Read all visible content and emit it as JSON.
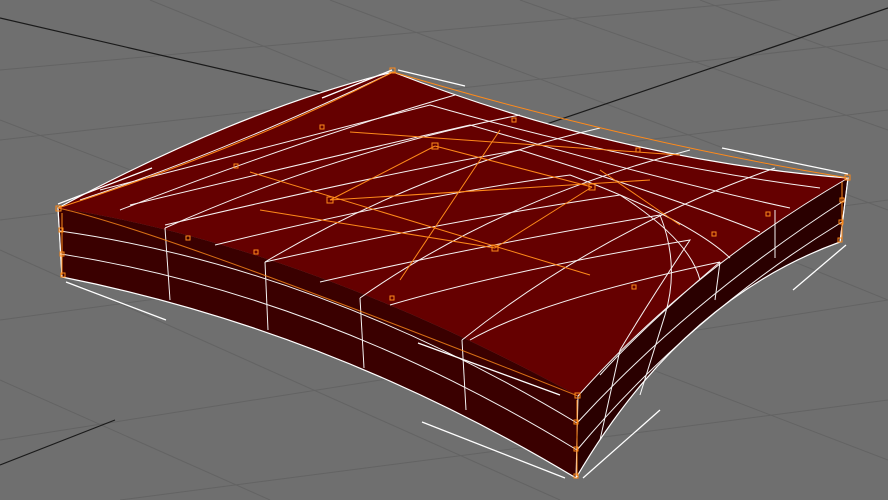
{
  "viewport": {
    "background_color": "#6f6f6f",
    "grid_color": "#636363",
    "axis_line_color": "#1a1a1a",
    "grid_visible": true
  },
  "object": {
    "type": "subdivided-box-with-ffd-lattice",
    "top_color": "#650000",
    "side_color": "#3a0000",
    "side_dark_color": "#2a0000",
    "wireframe_color": "#ffffff",
    "lattice_color": "#ff8a1a",
    "selected": true
  }
}
